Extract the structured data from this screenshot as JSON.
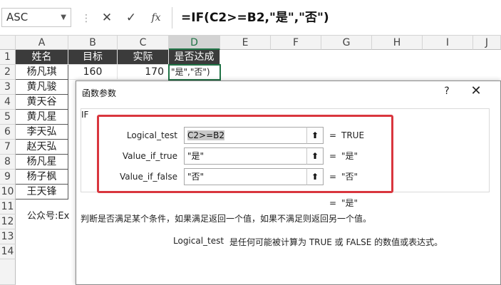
{
  "formula_bar": {
    "name_box": "ASC",
    "cancel_icon": "✕",
    "enter_icon": "✓",
    "fx_label": "fx",
    "formula": "=IF(C2>=B2,\"是\",\"否\")"
  },
  "grid": {
    "columns": [
      "A",
      "B",
      "C",
      "D",
      "E",
      "F",
      "G",
      "H",
      "I",
      "J"
    ],
    "rows": [
      "1",
      "2",
      "3",
      "4",
      "5",
      "6",
      "7",
      "8",
      "9",
      "10",
      "11",
      "12",
      "13",
      "14"
    ],
    "header": [
      "姓名",
      "目标",
      "实际",
      "是否达成"
    ],
    "names": [
      "杨凡琪",
      "黄凡骏",
      "黄天谷",
      "黄凡星",
      "李天弘",
      "赵天弘",
      "杨凡星",
      "杨子枫",
      "王天锋"
    ],
    "row2": {
      "target": "160",
      "actual": "170",
      "result": "\"是\",\"否\")"
    },
    "note": "公众号:Ex"
  },
  "dialog": {
    "title": "函数参数",
    "help": "?",
    "close": "✕",
    "function_name": "IF",
    "args": [
      {
        "label": "Logical_test",
        "value": "C2>=B2",
        "result": "TRUE"
      },
      {
        "label": "Value_if_true",
        "value": "\"是\"",
        "result": "\"是\""
      },
      {
        "label": "Value_if_false",
        "value": "\"否\"",
        "result": "\"否\""
      }
    ],
    "collapse_icon": "⬆",
    "equals": "=",
    "overall_result": "\"是\"",
    "description": "判断是否满足某个条件，如果满足返回一个值，如果不满足则返回另一个值。",
    "arg_help_name": "Logical_test",
    "arg_help_text": "是任何可能被计算为 TRUE 或 FALSE 的数值或表达式。"
  },
  "colors": {
    "header_bg": "#3b3b3b",
    "excel_green": "#217346",
    "highlight_red": "#d9363e"
  }
}
